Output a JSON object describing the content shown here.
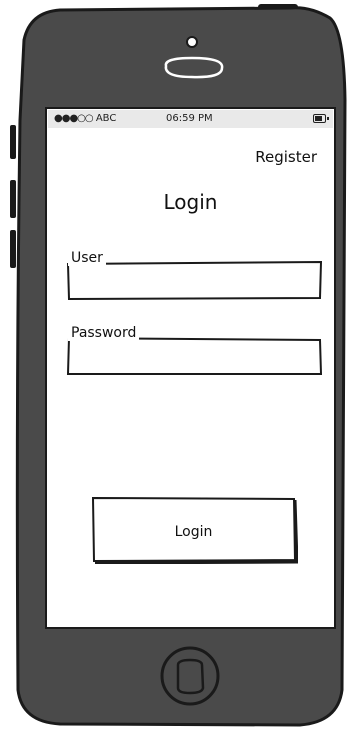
{
  "status_bar": {
    "signal": "●●●○○",
    "carrier": "ABC",
    "time": "06:59 PM"
  },
  "header": {
    "register_label": "Register",
    "title": "Login"
  },
  "form": {
    "user_label": "User",
    "user_value": "",
    "password_label": "Password",
    "password_value": "",
    "login_button_label": "Login"
  },
  "colors": {
    "phone_body": "#4a4a4a",
    "outline": "#1a1a1a",
    "status_bar_bg": "#e9e9e9"
  }
}
